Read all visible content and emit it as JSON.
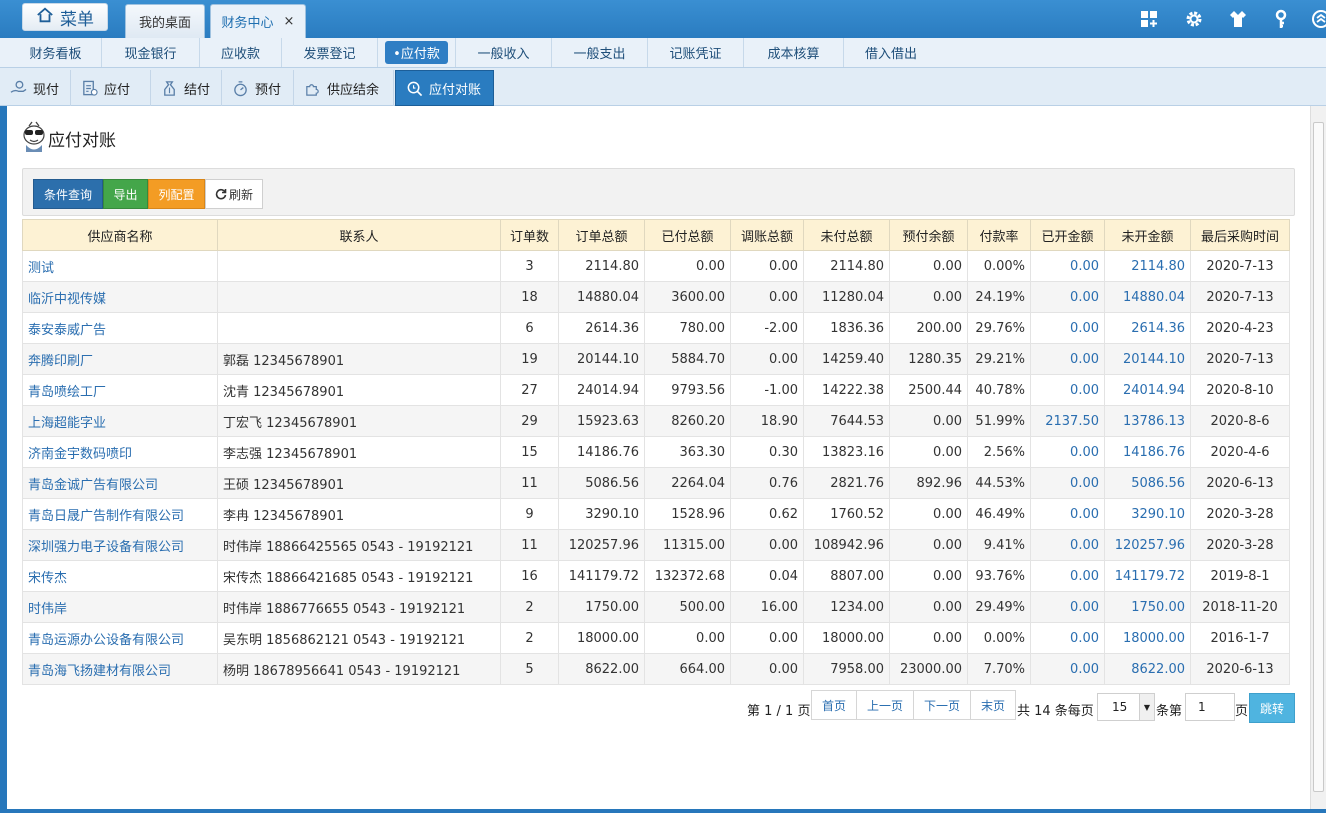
{
  "topbar": {
    "menu_label": "菜单",
    "tabs": [
      {
        "label": "我的桌面"
      },
      {
        "label": "财务中心",
        "close": "×"
      }
    ],
    "icons": [
      "grid-plus-icon",
      "gear-icon",
      "shirt-icon",
      "key-icon",
      "collapse-icon"
    ]
  },
  "nav": {
    "items": [
      "财务看板",
      "现金银行",
      "应收款",
      "发票登记",
      "•应付款",
      "一般收入",
      "一般支出",
      "记账凭证",
      "成本核算",
      "借入借出"
    ],
    "active_index": 4
  },
  "subtabs": {
    "items": [
      {
        "label": "现付",
        "icon": "hand-money-icon"
      },
      {
        "label": "应付",
        "icon": "document-icon"
      },
      {
        "label": "结付",
        "icon": "money-bag-icon"
      },
      {
        "label": "预付",
        "icon": "stopwatch-icon"
      },
      {
        "label": "供应结余",
        "icon": "puzzle-icon"
      },
      {
        "label": "应付对账",
        "icon": "search-icon"
      }
    ],
    "active_index": 5
  },
  "page": {
    "title": "应付对账"
  },
  "toolbar": {
    "query": "条件查询",
    "export": "导出",
    "columns": "列配置",
    "refresh": "刷新"
  },
  "table": {
    "headers": [
      "供应商名称",
      "联系人",
      "订单数",
      "订单总额",
      "已付总额",
      "调账总额",
      "未付总额",
      "预付余额",
      "付款率",
      "已开金额",
      "未开金额",
      "最后采购时间"
    ],
    "rows": [
      [
        "测试",
        "",
        "3",
        "2114.80",
        "0.00",
        "0.00",
        "2114.80",
        "0.00",
        "0.00%",
        "0.00",
        "2114.80",
        "2020-7-13"
      ],
      [
        "临沂中视传媒",
        "",
        "18",
        "14880.04",
        "3600.00",
        "0.00",
        "11280.04",
        "0.00",
        "24.19%",
        "0.00",
        "14880.04",
        "2020-7-13"
      ],
      [
        "泰安泰威广告",
        "",
        "6",
        "2614.36",
        "780.00",
        "-2.00",
        "1836.36",
        "200.00",
        "29.76%",
        "0.00",
        "2614.36",
        "2020-4-23"
      ],
      [
        "奔腾印刷厂",
        "郭磊 12345678901",
        "19",
        "20144.10",
        "5884.70",
        "0.00",
        "14259.40",
        "1280.35",
        "29.21%",
        "0.00",
        "20144.10",
        "2020-7-13"
      ],
      [
        "青岛喷绘工厂",
        "沈青 12345678901",
        "27",
        "24014.94",
        "9793.56",
        "-1.00",
        "14222.38",
        "2500.44",
        "40.78%",
        "0.00",
        "24014.94",
        "2020-8-10"
      ],
      [
        "上海超能字业",
        "丁宏飞 12345678901",
        "29",
        "15923.63",
        "8260.20",
        "18.90",
        "7644.53",
        "0.00",
        "51.99%",
        "2137.50",
        "13786.13",
        "2020-8-6"
      ],
      [
        "济南金宇数码喷印",
        "李志强 12345678901",
        "15",
        "14186.76",
        "363.30",
        "0.30",
        "13823.16",
        "0.00",
        "2.56%",
        "0.00",
        "14186.76",
        "2020-4-6"
      ],
      [
        "青岛金诚广告有限公司",
        "王硕 12345678901",
        "11",
        "5086.56",
        "2264.04",
        "0.76",
        "2821.76",
        "892.96",
        "44.53%",
        "0.00",
        "5086.56",
        "2020-6-13"
      ],
      [
        "青岛日晟广告制作有限公司",
        "李冉 12345678901",
        "9",
        "3290.10",
        "1528.96",
        "0.62",
        "1760.52",
        "0.00",
        "46.49%",
        "0.00",
        "3290.10",
        "2020-3-28"
      ],
      [
        "深圳强力电子设备有限公司",
        "时伟岸 18866425565 0543 - 19192121",
        "11",
        "120257.96",
        "11315.00",
        "0.00",
        "108942.96",
        "0.00",
        "9.41%",
        "0.00",
        "120257.96",
        "2020-3-28"
      ],
      [
        "宋传杰",
        "宋传杰 18866421685 0543 - 19192121",
        "16",
        "141179.72",
        "132372.68",
        "0.04",
        "8807.00",
        "0.00",
        "93.76%",
        "0.00",
        "141179.72",
        "2019-8-1"
      ],
      [
        "时伟岸",
        "时伟岸 1886776655 0543 - 19192121",
        "2",
        "1750.00",
        "500.00",
        "16.00",
        "1234.00",
        "0.00",
        "29.49%",
        "0.00",
        "1750.00",
        "2018-11-20"
      ],
      [
        "青岛运源办公设备有限公司",
        "吴东明 1856862121 0543 - 19192121",
        "2",
        "18000.00",
        "0.00",
        "0.00",
        "18000.00",
        "0.00",
        "0.00%",
        "0.00",
        "18000.00",
        "2016-1-7"
      ],
      [
        "青岛海飞扬建材有限公司",
        "杨明 18678956641 0543 - 19192121",
        "5",
        "8622.00",
        "664.00",
        "0.00",
        "7958.00",
        "23000.00",
        "7.70%",
        "0.00",
        "8622.00",
        "2020-6-13"
      ]
    ]
  },
  "pager": {
    "page_info": "第 1 / 1 页",
    "first": "首页",
    "prev": "上一页",
    "next": "下一页",
    "last": "末页",
    "total_text": "共 14 条每页",
    "page_size": "15",
    "goto_prefix": "条第",
    "goto_value": "1",
    "goto_suffix": "页",
    "go": "跳转"
  },
  "colors": {
    "topbar": "#2a7cc0",
    "active_tab": "#2a7cc0",
    "link": "#2a6eb0",
    "header_bg": "#fdf2d4",
    "btn_query": "#2c6fac",
    "btn_export": "#44a64a",
    "btn_columns": "#f39c24",
    "btn_go": "#4fb4e0"
  }
}
